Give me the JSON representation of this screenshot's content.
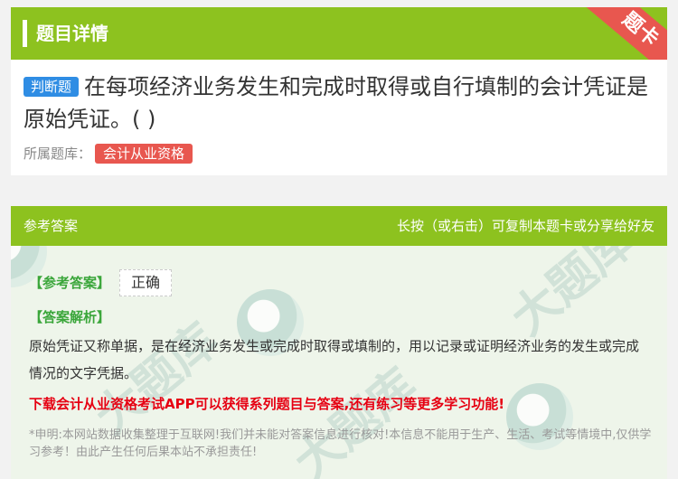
{
  "header": {
    "title": "题目详情",
    "corner_ribbon": "题卡"
  },
  "question": {
    "type_badge": "判断题",
    "text": "在每项经济业务发生和完成时取得或自行填制的会计凭证是原始凭证。( )",
    "bank_label": "所属题库：",
    "bank_name": "会计从业资格"
  },
  "answer_section": {
    "header_left": "参考答案",
    "header_right": "长按（或右击）可复制本题卡或分享给好友",
    "answer_label": "【参考答案】",
    "answer_value": "正确",
    "analysis_label": "【答案解析】",
    "analysis_text": "原始凭证又称单据，是在经济业务发生或完成时取得或填制的，用以记录或证明经济业务的发生或完成情况的文字凭据。",
    "promo_text": "下载会计从业资格考试APP可以获得系列题目与答案,还有练习等更多学习功能!",
    "disclaimer": "*申明:本网站数据收集整理于互联网!我们并未能对答案信息进行核对!本信息不能用于生产、生活、考试等情境中,仅供学习参考！由此产生任何后果本站不承担责任!"
  },
  "watermark": {
    "text": "大题库",
    "colors": {
      "accent": "#8dc21f",
      "red": "#e8574f",
      "blue": "#2f8de4"
    }
  }
}
